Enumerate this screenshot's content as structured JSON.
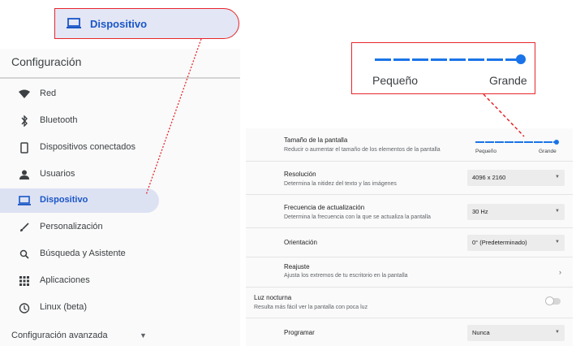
{
  "callout_device": {
    "label": "Dispositivo",
    "icon": "laptop-icon"
  },
  "callout_size": {
    "small_label": "Pequeño",
    "large_label": "Grande",
    "slider_level": 1.0
  },
  "left_panel": {
    "title": "Configuración",
    "items": [
      {
        "label": "Red",
        "icon": "wifi-icon"
      },
      {
        "label": "Bluetooth",
        "icon": "bluetooth-icon"
      },
      {
        "label": "Dispositivos conectados",
        "icon": "phone-icon"
      },
      {
        "label": "Usuarios",
        "icon": "person-icon"
      },
      {
        "label": "Dispositivo",
        "icon": "laptop-icon",
        "active": true
      },
      {
        "label": "Personalización",
        "icon": "brush-icon"
      },
      {
        "label": "Búsqueda y Asistente",
        "icon": "search-icon"
      },
      {
        "label": "Aplicaciones",
        "icon": "apps-grid-icon"
      },
      {
        "label": "Linux (beta)",
        "icon": "linux-icon"
      }
    ],
    "advanced": "Configuración avanzada"
  },
  "right_panel": {
    "screen_size": {
      "title": "Tamaño de la pantalla",
      "desc": "Reducir o aumentar el tamaño de los elementos de la pantalla",
      "small": "Pequeño",
      "large": "Grande"
    },
    "resolution": {
      "title": "Resolución",
      "desc": "Determina la nitidez del texto y las imágenes",
      "value": "4096 x 2160"
    },
    "refresh": {
      "title": "Frecuencia de actualización",
      "desc": "Determina la frecuencia con la que se actualiza la pantalla",
      "value": "30 Hz"
    },
    "orientation": {
      "title": "Orientación",
      "value": "0° (Predeterminado)"
    },
    "adjust": {
      "title": "Reajuste",
      "desc": "Ajusta los extremos de tu escritorio en la pantalla"
    },
    "night_light": {
      "title": "Luz nocturna",
      "desc": "Resulta más fácil ver la pantalla con poca luz",
      "enabled": false
    },
    "schedule": {
      "title": "Programar",
      "value": "Nunca"
    }
  },
  "colors": {
    "accent": "#1a73e8",
    "active_text": "#1a56c7",
    "callout_border": "#e8262b",
    "active_bg": "#dde2f3"
  }
}
